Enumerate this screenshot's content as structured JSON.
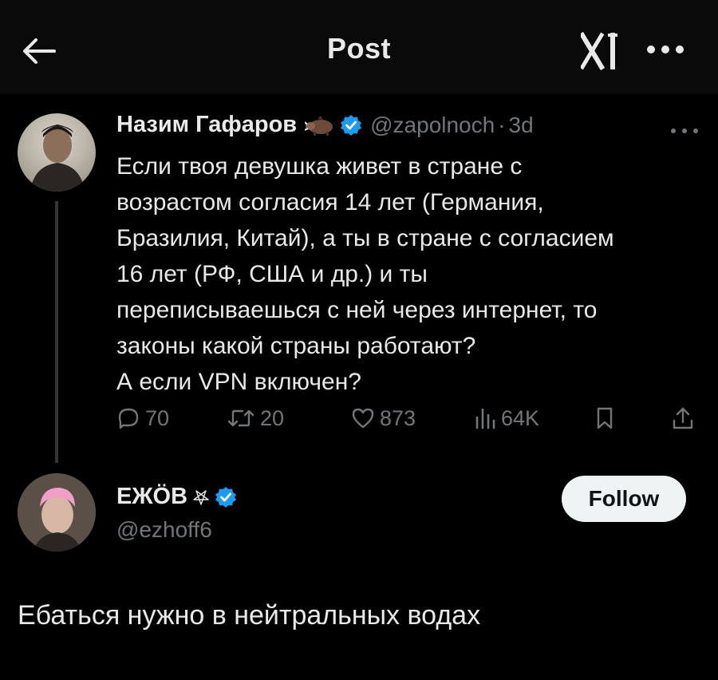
{
  "header": {
    "title": "Post",
    "back_icon": "arrow-left-icon",
    "logo_icon": "x-logo-icon",
    "more_icon": "more-horizontal-icon"
  },
  "parent_post": {
    "author": {
      "display_name": "Назим Гафаров",
      "handle": "@zapolnoch",
      "time": "3d",
      "emoji": "boar-emoji",
      "verified": true
    },
    "text_lines": [
      "Если твоя девушка живет в стране с",
      "возрастом согласия 14 лет (Германия,",
      "Бразилия, Китай), а ты в стране с согласием",
      "16 лет (РФ, США и др.) и ты",
      "переписываешься с ней через интернет, то",
      "законы какой страны работают?",
      "А если VPN включен?"
    ],
    "stats": {
      "replies": "70",
      "reposts": "20",
      "likes": "873",
      "views": "64K"
    }
  },
  "reply_post": {
    "author": {
      "display_name": "ЕЖÖВ",
      "handle": "@ezhoff6",
      "verified": true
    },
    "follow_label": "Follow",
    "text": "Ебаться нужно в нейтральных водах"
  },
  "colors": {
    "background": "#000000",
    "text": "#e7e9ea",
    "muted": "#71767b",
    "verified_blue": "#1d9bf0",
    "follow_bg": "#eff3f4"
  }
}
